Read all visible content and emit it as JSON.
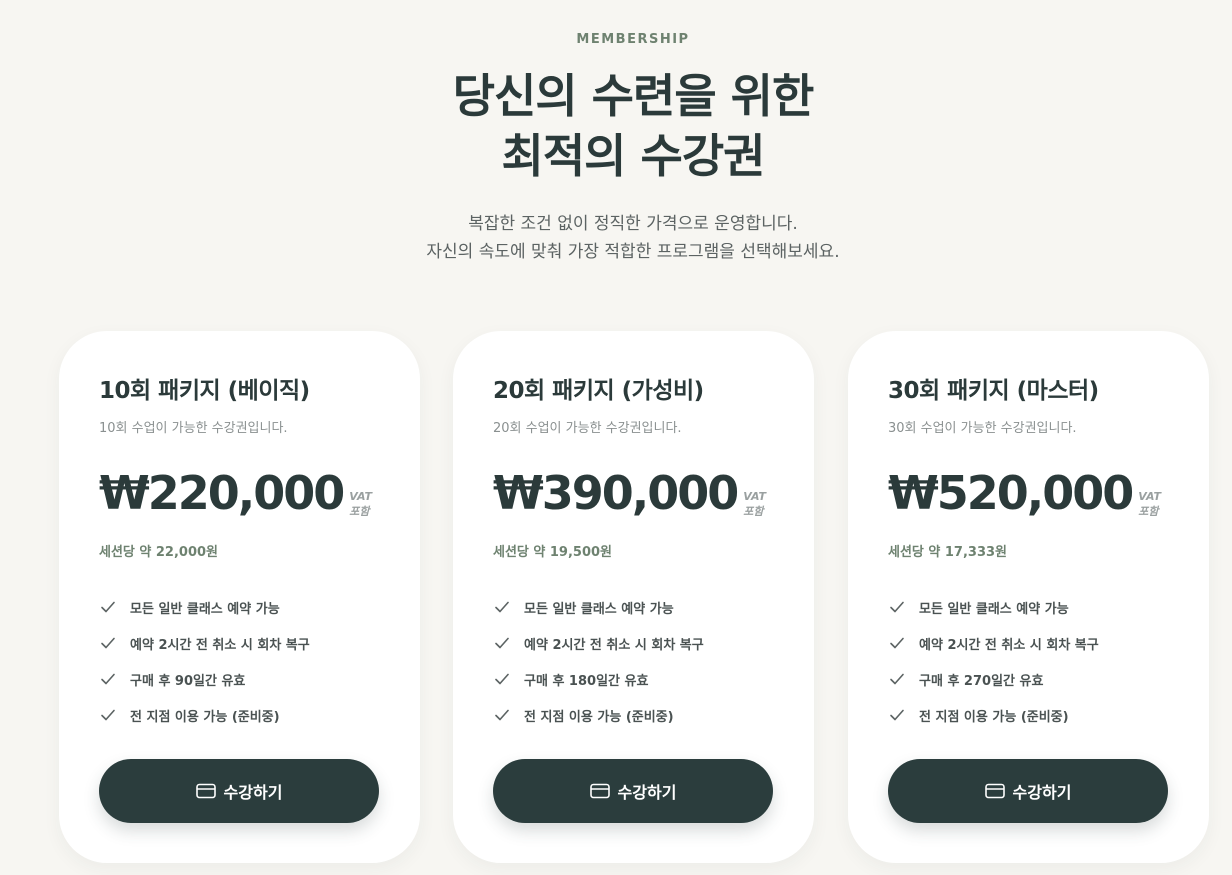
{
  "header": {
    "eyebrow": "MEMBERSHIP",
    "headline_line1": "당신의 수련을 위한",
    "headline_line2": "최적의 수강권",
    "subtitle_line1": "복잡한 조건 없이 정직한 가격으로 운영합니다.",
    "subtitle_line2": "자신의 속도에 맞춰 가장 적합한 프로그램을 선택해보세요."
  },
  "plans": [
    {
      "title": "10회 패키지 (베이직)",
      "description": "10회 수업이 가능한 수강권입니다.",
      "price": "₩220,000",
      "vat_line1": "VAT",
      "vat_line2": "포함",
      "per_session": "세션당 약 22,000원",
      "features": [
        "모든 일반 클래스 예약 가능",
        "예약 2시간 전 취소 시 회차 복구",
        "구매 후 90일간 유효",
        "전 지점 이용 가능 (준비중)"
      ],
      "cta_label": "수강하기"
    },
    {
      "title": "20회 패키지 (가성비)",
      "description": "20회 수업이 가능한 수강권입니다.",
      "price": "₩390,000",
      "vat_line1": "VAT",
      "vat_line2": "포함",
      "per_session": "세션당 약 19,500원",
      "features": [
        "모든 일반 클래스 예약 가능",
        "예약 2시간 전 취소 시 회차 복구",
        "구매 후 180일간 유효",
        "전 지점 이용 가능 (준비중)"
      ],
      "cta_label": "수강하기"
    },
    {
      "title": "30회 패키지 (마스터)",
      "description": "30회 수업이 가능한 수강권입니다.",
      "price": "₩520,000",
      "vat_line1": "VAT",
      "vat_line2": "포함",
      "per_session": "세션당 약 17,333원",
      "features": [
        "모든 일반 클래스 예약 가능",
        "예약 2시간 전 취소 시 회차 복구",
        "구매 후 270일간 유효",
        "전 지점 이용 가능 (준비중)"
      ],
      "cta_label": "수강하기"
    }
  ],
  "icons": {
    "feature": "check-icon",
    "cta": "credit-card-icon"
  },
  "colors": {
    "background": "#f7f6f2",
    "primary": "#2b3d3d",
    "accent": "#6e8270",
    "card": "#ffffff"
  }
}
